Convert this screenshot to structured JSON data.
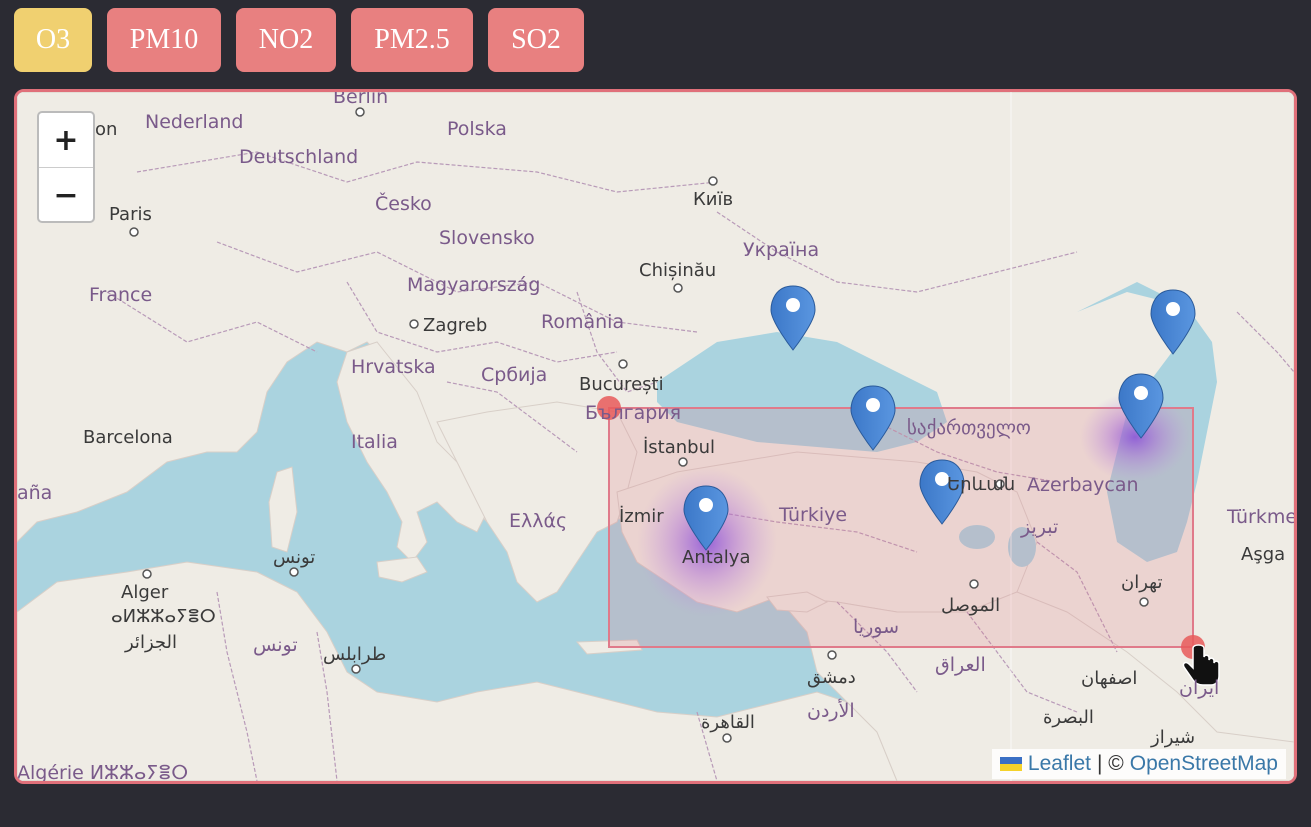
{
  "pollutants": [
    {
      "label": "O3",
      "color": "#f0d070",
      "selected": true
    },
    {
      "label": "PM10",
      "color": "#e88080",
      "selected": false
    },
    {
      "label": "NO2",
      "color": "#e88080",
      "selected": false
    },
    {
      "label": "PM2.5",
      "color": "#e88080",
      "selected": false
    },
    {
      "label": "SO2",
      "color": "#e88080",
      "selected": false
    }
  ],
  "map": {
    "zoom_in": "+",
    "zoom_out": "−",
    "labels": {
      "berlin": "Berlin",
      "nederland": "Nederland",
      "polska": "Polska",
      "deutschland": "Deutschland",
      "paris": "Paris",
      "cesko": "Česko",
      "kyiv": "Київ",
      "slovensko": "Slovensko",
      "ukraina": "Україна",
      "france": "France",
      "chisinau": "Chișinău",
      "magyarorszag": "Magyarország",
      "zagreb": "Zagreb",
      "romania": "România",
      "hrvatska": "Hrvatska",
      "srbija": "Србија",
      "bucuresti": "București",
      "bulgaria": "България",
      "barcelona": "Barcelona",
      "italia": "Italia",
      "istanbul": "İstanbul",
      "georgia": "საქართველო",
      "azerbaycan": "Azerbaycan",
      "turkmen": "Türkme",
      "ashgabat": "Aşga",
      "espana": "aña",
      "izmir": "İzmir",
      "ellas": "Ελλάς",
      "turkiye": "Türkiye",
      "tabriz": "تبریز",
      "yerevan": "Երևան",
      "tunis_city": "تونس",
      "antalya": "Antalya",
      "alger": "Alger",
      "alger_tif": "ⴰⵍⵣⵣⴰⵢⴻⵔ",
      "aljazair": "الجزائر",
      "tunis_country": "تونس",
      "mosul": "الموصل",
      "tehran": "تهران",
      "tarabulus": "طرابلس",
      "suriya": "سوريا",
      "iraq": "العراق",
      "dimashq": "دمشق",
      "isfahan": "اصفهان",
      "iran": "ایران",
      "urdun": "الأردن",
      "basra": "البصرة",
      "qahira": "القاهرة",
      "shiraz": "شیراز",
      "algerie": "Algérie ⵍⵣⵣⴰⵢⴻⵔ",
      "on": "on"
    },
    "markers": 6,
    "heat_spots": 2,
    "selection_box": "present"
  },
  "attribution": {
    "leaflet": "Leaflet",
    "separator": "| ©",
    "osm": "OpenStreetMap",
    "flag_colors": [
      "#3a6fc4",
      "#f5d22a"
    ]
  }
}
